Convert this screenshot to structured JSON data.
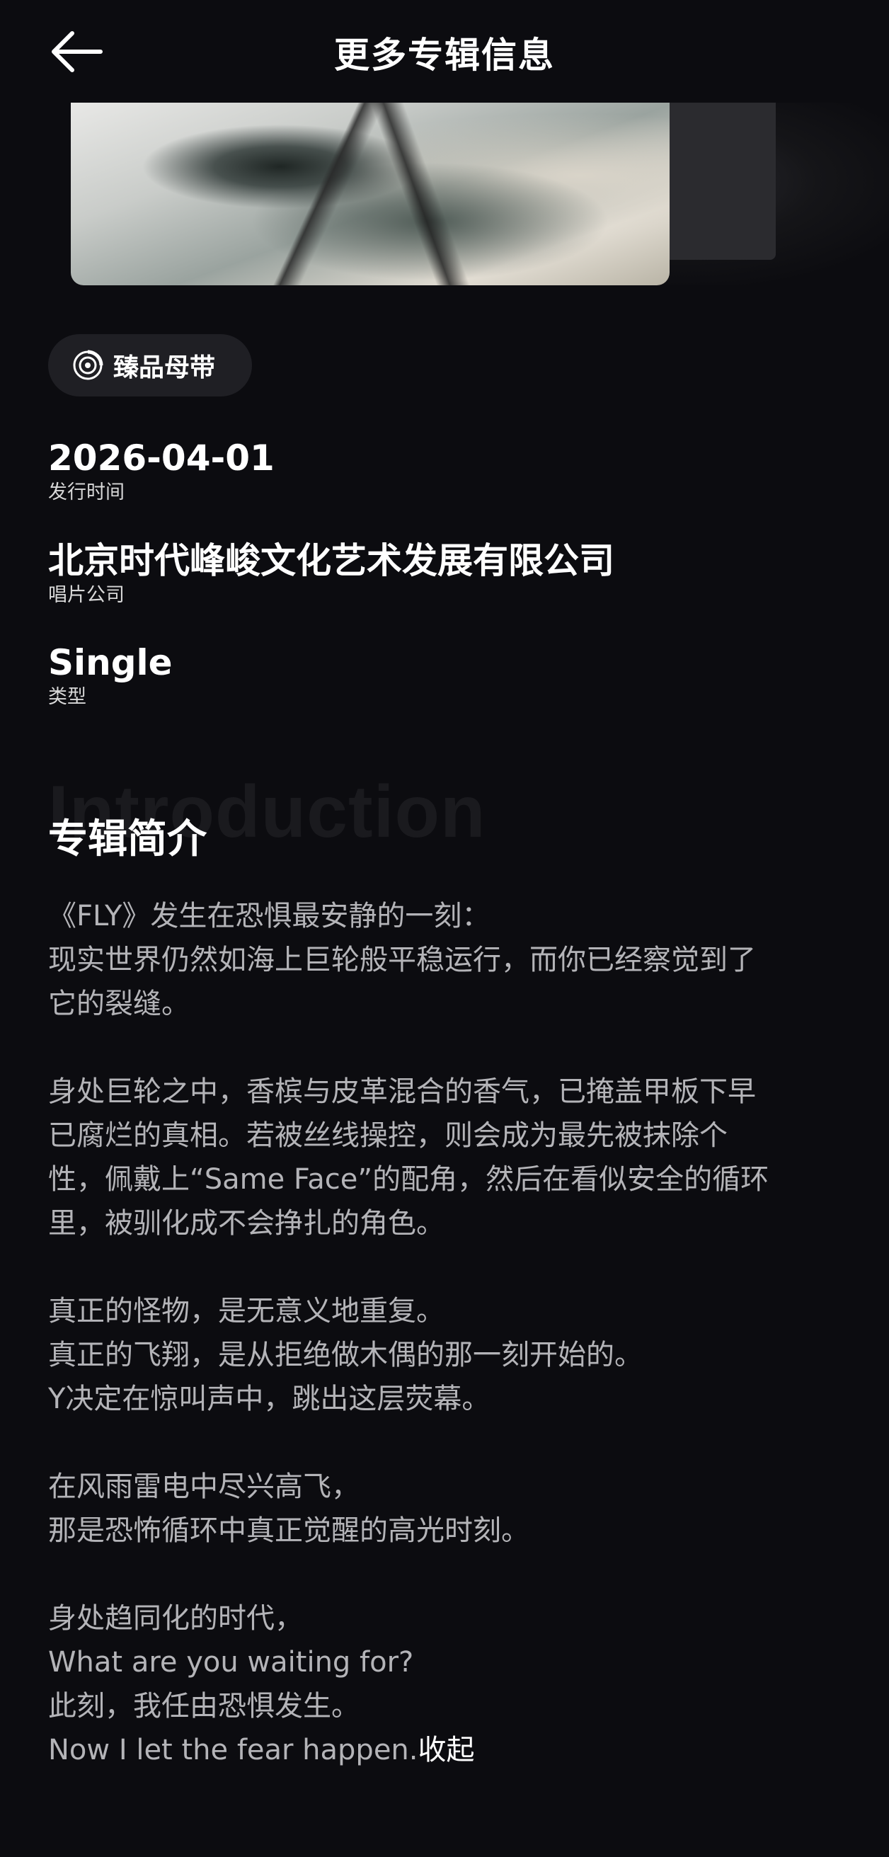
{
  "header": {
    "title": "更多专辑信息"
  },
  "badge": {
    "label": "臻品母带",
    "icon": "master-tape-icon"
  },
  "info": [
    {
      "value": "2026-04-01",
      "label": "发行时间"
    },
    {
      "value": "北京时代峰峻文化艺术发展有限公司",
      "label": "唱片公司"
    },
    {
      "value": "Single",
      "label": "类型"
    }
  ],
  "intro": {
    "bg_text": "Introduction",
    "title": "专辑简介",
    "lines": [
      "《FLY》发生在恐惧最安静的一刻：",
      "现实世界仍然如海上巨轮般平稳运行，而你已经察觉到了",
      "它的裂缝。",
      "",
      "身处巨轮之中，香槟与皮革混合的香气，已掩盖甲板下早",
      "已腐烂的真相。若被丝线操控，则会成为最先被抹除个",
      "性，佩戴上“Same Face”的配角，然后在看似安全的循环",
      "里，被驯化成不会挣扎的角色。",
      "",
      "真正的怪物，是无意义地重复。",
      "真正的飞翔，是从拒绝做木偶的那一刻开始的。",
      "Y决定在惊叫声中，跳出这层荧幕。",
      "",
      "在风雨雷电中尽兴高飞，",
      "那是恐怖循环中真正觉醒的高光时刻。",
      "",
      "身处趋同化的时代，",
      "What are you waiting for?",
      "此刻，我任由恐惧发生。",
      "Now I let the fear happen."
    ],
    "collapse_label": "收起"
  }
}
